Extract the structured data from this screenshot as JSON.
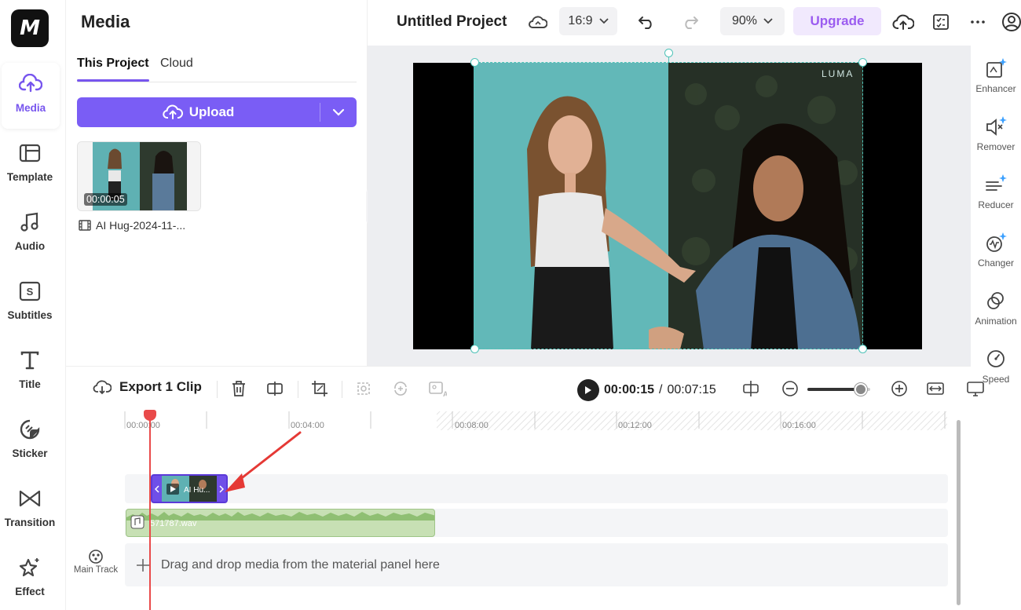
{
  "app": {
    "logo_text": "M"
  },
  "nav": {
    "items": [
      {
        "label": "Media",
        "icon": "cloud-upload-icon",
        "active": true
      },
      {
        "label": "Template",
        "icon": "template-icon"
      },
      {
        "label": "Audio",
        "icon": "music-note-icon"
      },
      {
        "label": "Subtitles",
        "icon": "subtitles-icon"
      },
      {
        "label": "Title",
        "icon": "title-text-icon"
      },
      {
        "label": "Sticker",
        "icon": "sticker-icon"
      },
      {
        "label": "Transition",
        "icon": "transition-icon"
      },
      {
        "label": "Effect",
        "icon": "effect-sparkle-icon"
      }
    ]
  },
  "media_panel": {
    "title": "Media",
    "tabs": [
      {
        "label": "This Project",
        "active": true
      },
      {
        "label": "Cloud",
        "active": false
      }
    ],
    "upload_label": "Upload",
    "items": [
      {
        "duration": "00:00:05",
        "name": "AI Hug-2024-11-..."
      }
    ]
  },
  "top_bar": {
    "project_title": "Untitled Project",
    "aspect_ratio": "16:9",
    "zoom": "90%",
    "upgrade_label": "Upgrade"
  },
  "preview": {
    "watermark": "LUMA"
  },
  "right_tools": [
    {
      "label": "Enhancer",
      "icon": "enhancer-icon"
    },
    {
      "label": "Remover",
      "icon": "remover-icon"
    },
    {
      "label": "Reducer",
      "icon": "reducer-icon"
    },
    {
      "label": "Changer",
      "icon": "voice-changer-icon"
    },
    {
      "label": "Animation",
      "icon": "animation-icon"
    },
    {
      "label": "Speed",
      "icon": "speed-icon"
    }
  ],
  "timeline_toolbar": {
    "export_label": "Export 1 Clip",
    "current_time": "00:00:15",
    "separator": "/",
    "total_time": "00:07:15",
    "zoom_level": 0.85
  },
  "timeline": {
    "ruler": [
      "00:00:00",
      "00:04:00",
      "00:08:00",
      "00:12:00",
      "00:16:00"
    ],
    "video_clip_label": "AI Hu...",
    "audio_clip_label": "571787.wav",
    "drop_text": "Drag and drop media from the material panel here",
    "main_track_label": "Main Track"
  },
  "colors": {
    "accent": "#7A5DF5",
    "playhead": "#E94A4A",
    "audio_clip": "#C7E0B4",
    "annotation_arrow": "#E53935"
  }
}
